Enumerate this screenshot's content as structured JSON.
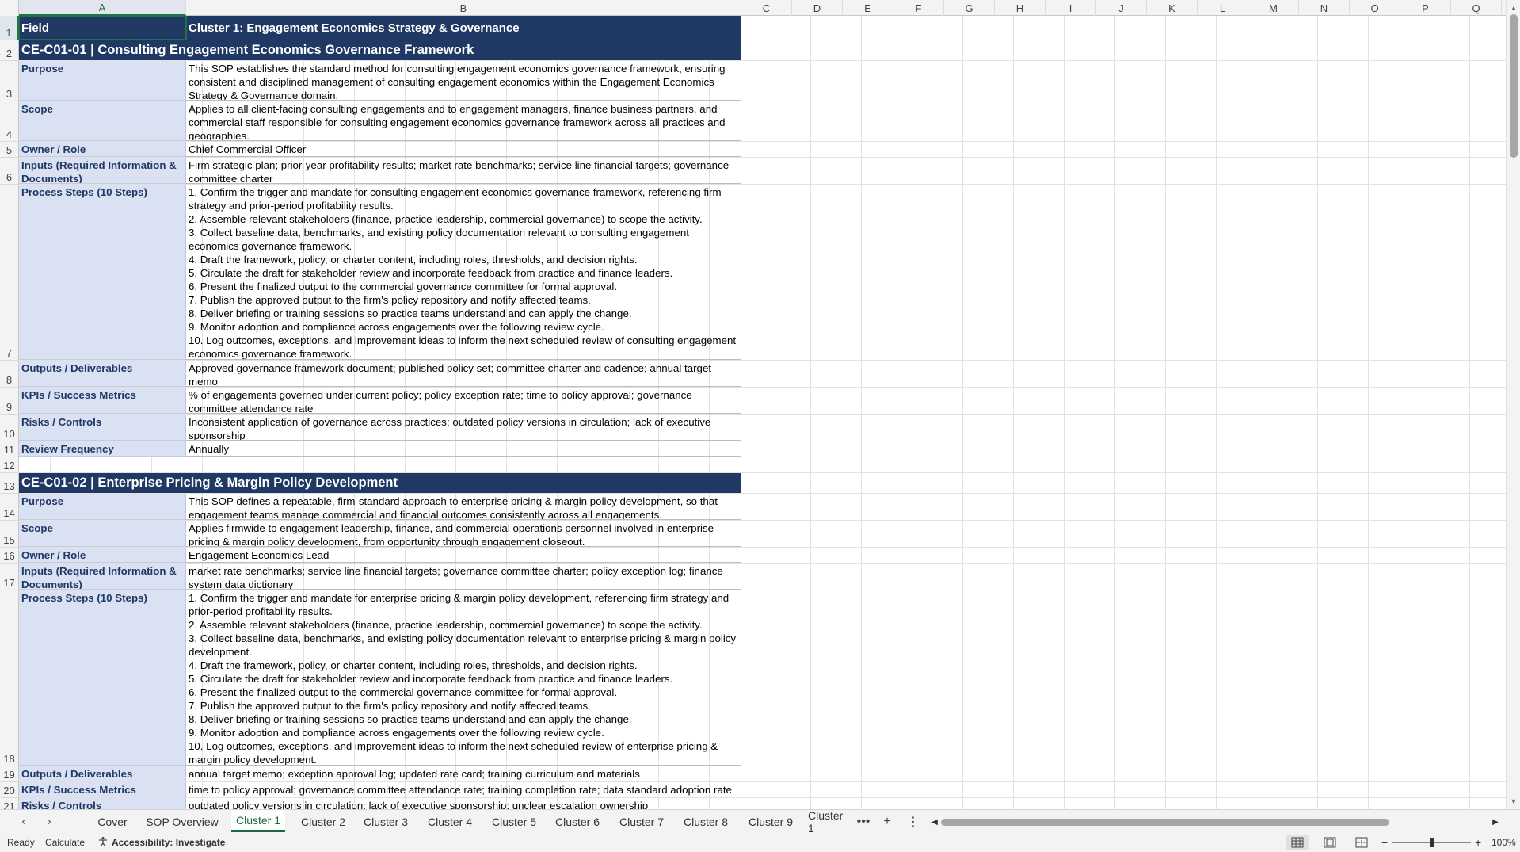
{
  "columns": [
    "A",
    "B",
    "C",
    "D",
    "E",
    "F",
    "G",
    "H",
    "I",
    "J",
    "K",
    "L",
    "M",
    "N",
    "O",
    "P",
    "Q"
  ],
  "selected_column": "A",
  "selected_row": "1",
  "rows": [
    {
      "num": "1",
      "type": "header",
      "a": "Field",
      "b": "Cluster 1: Engagement Economics Strategy & Governance"
    },
    {
      "num": "2",
      "type": "section",
      "text": "CE-C01-01  |  Consulting Engagement Economics Governance Framework"
    },
    {
      "num": "3",
      "type": "field",
      "a": "Purpose",
      "b": "This SOP establishes the standard method for consulting engagement economics governance framework, ensuring consistent and disciplined management of consulting engagement economics within the Engagement Economics Strategy & Governance domain."
    },
    {
      "num": "4",
      "type": "field",
      "a": "Scope",
      "b": "Applies to all client-facing consulting engagements and to engagement managers, finance business partners, and commercial staff responsible for consulting engagement economics governance framework across all practices and geographies."
    },
    {
      "num": "5",
      "type": "field",
      "a": "Owner / Role",
      "b": "Chief Commercial Officer"
    },
    {
      "num": "6",
      "type": "field",
      "a": "Inputs (Required Information & Documents)",
      "b": "Firm strategic plan; prior-year profitability results; market rate benchmarks; service line financial targets; governance committee charter"
    },
    {
      "num": "7",
      "type": "field",
      "a": "Process Steps (10 Steps)",
      "b": "1. Confirm the trigger and mandate for consulting engagement economics governance framework, referencing firm strategy and prior-period profitability results.\n2. Assemble relevant stakeholders (finance, practice leadership, commercial governance) to scope the activity.\n3. Collect baseline data, benchmarks, and existing policy documentation relevant to consulting engagement economics governance framework.\n4. Draft the framework, policy, or charter content, including roles, thresholds, and decision rights.\n5. Circulate the draft for stakeholder review and incorporate feedback from practice and finance leaders.\n6. Present the finalized output to the commercial governance committee for formal approval.\n7. Publish the approved output to the firm's policy repository and notify affected teams.\n8. Deliver briefing or training sessions so practice teams understand and can apply the change.\n9. Monitor adoption and compliance across engagements over the following review cycle.\n10. Log outcomes, exceptions, and improvement ideas to inform the next scheduled review of consulting engagement economics governance framework."
    },
    {
      "num": "8",
      "type": "field",
      "a": "Outputs / Deliverables",
      "b": "Approved governance framework document; published policy set; committee charter and cadence; annual target memo"
    },
    {
      "num": "9",
      "type": "field",
      "a": "KPIs / Success Metrics",
      "b": "% of engagements governed under current policy; policy exception rate; time to policy approval; governance committee attendance rate"
    },
    {
      "num": "10",
      "type": "field",
      "a": "Risks / Controls",
      "b": "Inconsistent application of governance across practices; outdated policy versions in circulation; lack of executive sponsorship"
    },
    {
      "num": "11",
      "type": "field",
      "a": "Review Frequency",
      "b": "Annually"
    },
    {
      "num": "12",
      "type": "blank"
    },
    {
      "num": "13",
      "type": "section",
      "text": "CE-C01-02  |  Enterprise Pricing & Margin Policy Development"
    },
    {
      "num": "14",
      "type": "field",
      "a": "Purpose",
      "b": "This SOP defines a repeatable, firm-standard approach to enterprise pricing & margin policy development, so that engagement teams manage commercial and financial outcomes consistently across all engagements."
    },
    {
      "num": "15",
      "type": "field",
      "a": "Scope",
      "b": "Applies firmwide to engagement leadership, finance, and commercial operations personnel involved in enterprise pricing & margin policy development, from opportunity through engagement closeout."
    },
    {
      "num": "16",
      "type": "field",
      "a": "Owner / Role",
      "b": "Engagement Economics Lead"
    },
    {
      "num": "17",
      "type": "field",
      "a": "Inputs (Required Information & Documents)",
      "b": "market rate benchmarks; service line financial targets; governance committee charter; policy exception log; finance system data dictionary"
    },
    {
      "num": "18",
      "type": "field",
      "a": "Process Steps (10 Steps)",
      "b": "1. Confirm the trigger and mandate for enterprise pricing & margin policy development, referencing firm strategy and prior-period profitability results.\n2. Assemble relevant stakeholders (finance, practice leadership, commercial governance) to scope the activity.\n3. Collect baseline data, benchmarks, and existing policy documentation relevant to enterprise pricing & margin policy development.\n4. Draft the framework, policy, or charter content, including roles, thresholds, and decision rights.\n5. Circulate the draft for stakeholder review and incorporate feedback from practice and finance leaders.\n6. Present the finalized output to the commercial governance committee for formal approval.\n7. Publish the approved output to the firm's policy repository and notify affected teams.\n8. Deliver briefing or training sessions so practice teams understand and can apply the change.\n9. Monitor adoption and compliance across engagements over the following review cycle.\n10. Log outcomes, exceptions, and improvement ideas to inform the next scheduled review of enterprise pricing & margin policy development."
    },
    {
      "num": "19",
      "type": "field",
      "a": "Outputs / Deliverables",
      "b": "annual target memo; exception approval log; updated rate card; training curriculum and materials"
    },
    {
      "num": "20",
      "type": "field",
      "a": "KPIs / Success Metrics",
      "b": "time to policy approval; governance committee attendance rate; training completion rate; data standard adoption rate"
    },
    {
      "num": "21",
      "type": "field",
      "a": "Risks / Controls",
      "b": "outdated policy versions in circulation; lack of executive sponsorship; unclear escalation ownership"
    }
  ],
  "sheet_tabs": [
    "Cover",
    "SOP Overview",
    "Cluster 1",
    "Cluster 2",
    "Cluster 3",
    "Cluster 4",
    "Cluster 5",
    "Cluster 6",
    "Cluster 7",
    "Cluster 8",
    "Cluster 9",
    "Cluster 1"
  ],
  "active_tab": "Cluster 1",
  "status": {
    "ready": "Ready",
    "calculate": "Calculate",
    "accessibility": "Accessibility: Investigate",
    "zoom": "100%"
  },
  "icons": {
    "prev_sheet": "chevron-left-icon",
    "next_sheet": "chevron-right-icon",
    "more_sheets": "ellipsis-icon",
    "add_sheet": "plus-icon",
    "sheet_menu": "vertical-ellipsis-icon",
    "accessibility": "accessibility-icon",
    "normal_view": "grid-view-icon",
    "page_layout": "page-layout-icon",
    "page_break": "page-break-icon"
  },
  "colors": {
    "header_fill": "#1f3864",
    "field_fill": "#d9e1f2",
    "field_text": "#1f3864",
    "accent": "#217346"
  }
}
